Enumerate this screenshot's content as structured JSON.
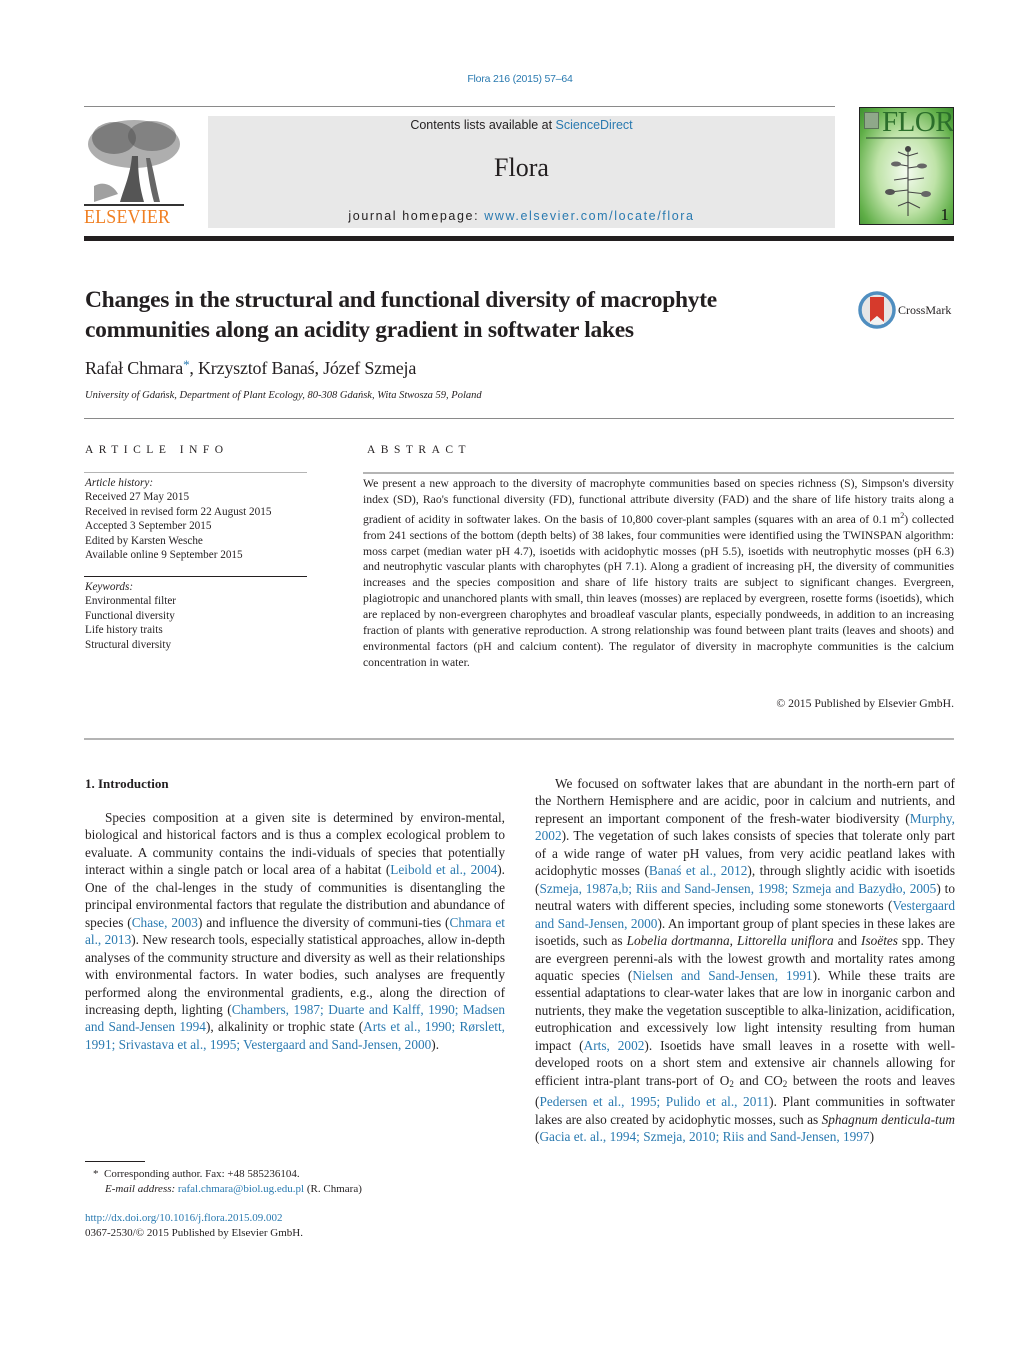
{
  "header": {
    "citation": "Flora 216 (2015) 57–64",
    "contents_prefix": "Contents lists available at ",
    "contents_link": "ScienceDirect",
    "journal_name": "Flora",
    "homepage_prefix": "journal homepage: ",
    "homepage_link": "www.elsevier.com/locate/flora",
    "publisher_logo_text": "ELSEVIER",
    "cover": {
      "title": "FLORA",
      "issue_number": "1"
    }
  },
  "article": {
    "title_line1": "Changes in the structural and functional diversity of macrophyte",
    "title_line2": "communities along an acidity gradient in softwater lakes",
    "crossmark_label": "CrossMark",
    "authors": [
      {
        "name": "Rafał Chmara",
        "marker": "*"
      },
      {
        "name": "Krzysztof Banaś"
      },
      {
        "name": "Józef Szmeja"
      }
    ],
    "affiliation": "University of Gdańsk, Department of Plant Ecology, 80-308 Gdańsk, Wita Stwosza 59, Poland"
  },
  "article_info": {
    "heading": "ARTICLE INFO",
    "history_label": "Article history:",
    "history": [
      "Received 27 May 2015",
      "Received in revised form 22 August 2015",
      "Accepted 3 September 2015",
      "Edited by Karsten Wesche",
      "Available online 9 September 2015"
    ],
    "keywords_label": "Keywords:",
    "keywords": [
      "Environmental filter",
      "Functional diversity",
      "Life history traits",
      "Structural diversity"
    ]
  },
  "abstract": {
    "heading": "ABSTRACT",
    "text_part1": "We present a new approach to the diversity of macrophyte communities based on species richness (S), Simpson's diversity index (SD), Rao's functional diversity (FD), functional attribute diversity (FAD) and the share of life history traits along a gradient of acidity in softwater lakes. On the basis of 10,800 cover-plant samples (squares with an area of 0.1 m",
    "text_sup": "2",
    "text_part2": ") collected from 241 sections of the bottom (depth belts) of 38 lakes, four communities were identified using the TWINSPAN algorithm: moss carpet (median water pH 4.7), isoetids with acidophytic mosses (pH 5.5), isoetids with neutrophytic mosses (pH 6.3) and neutrophytic vascular plants with charophytes (pH 7.1). Along a gradient of increasing pH, the diversity of communities increases and the species composition and share of life history traits are subject to significant changes. Evergreen, plagiotropic and unanchored plants with small, thin leaves (mosses) are replaced by evergreen, rosette forms (isoetids), which are replaced by non-evergreen charophytes and broadleaf vascular plants, especially pondweeds, in addition to an increasing fraction of plants with generative reproduction. A strong relationship was found between plant traits (leaves and shoots) and environmental factors (pH and calcium content). The regulator of diversity in macrophyte communities is the calcium concentration in water.",
    "copyright": "© 2015 Published by Elsevier GmbH."
  },
  "introduction": {
    "heading": "1.  Introduction",
    "left": {
      "t1": "Species composition at a given site is determined by environ-mental, biological and historical factors and is thus a complex ecological problem to evaluate. A community contains the indi-viduals of species that potentially interact within a single patch or local area of a habitat (",
      "c1": "Leibold et al., 2004",
      "t2": "). One of the chal-lenges in the study of communities is disentangling the principal environmental factors that regulate the distribution and abundance of species (",
      "c2": "Chase, 2003",
      "t3": ") and influence the diversity of communi-ties (",
      "c3": "Chmara et al., 2013",
      "t4": "). New research tools, especially statistical approaches, allow in-depth analyses of the community structure and diversity as well as their relationships with environmental factors. In water bodies, such analyses are frequently performed along the environmental gradients, e.g., along the direction of increasing depth, lighting (",
      "c4": "Chambers, 1987; Duarte and Kalff, 1990; Madsen and Sand-Jensen 1994",
      "t5": "), alkalinity or trophic state (",
      "c5": "Arts et al., 1990; Rørslett, 1991; Srivastava et al., 1995; Vestergaard and Sand-Jensen, 2000",
      "t6": ")."
    },
    "right": {
      "t1": "We focused on softwater lakes that are abundant in the north-ern part of the Northern Hemisphere and are acidic, poor in calcium and nutrients, and represent an important component of the fresh-water biodiversity (",
      "c1": "Murphy, 2002",
      "t2": "). The vegetation of such lakes consists of species that tolerate only part of a wide range of water pH values, from very acidic peatland lakes with acidophytic mosses (",
      "c2": "Banaś et al., 2012",
      "t3": "), through slightly acidic with isoetids (",
      "c3": "Szmeja, 1987a,b; Riis and Sand-Jensen, 1998; Szmeja and Bazydło, 2005",
      "t4": ") to neutral waters with different species, including some stoneworts (",
      "c4": "Vestergaard and Sand-Jensen, 2000",
      "t5": "). An important group of plant species in these lakes are isoetids, such as ",
      "i1": "Lobelia dortmanna",
      "t6": ", ",
      "i2": "Littorella uniflora",
      "t7": " and ",
      "i3": "Isoëtes",
      "t8": " spp. They are evergreen perenni-als with the lowest growth and mortality rates among aquatic species (",
      "c5": "Nielsen and Sand-Jensen, 1991",
      "t9": "). While these traits are essential adaptations to clear-water lakes that are low in inorganic carbon and nutrients, they make the vegetation susceptible to alka-linization, acidification, eutrophication and excessively low light intensity resulting from human impact (",
      "c6": "Arts, 2002",
      "t10": "). Isoetids have small leaves in a rosette with well-developed roots on a short stem and extensive air channels allowing for efficient intra-plant trans-port of O",
      "sub1": "2",
      "t11": " and CO",
      "sub2": "2",
      "t12": " between the roots and leaves (",
      "c7": "Pedersen et al., 1995; Pulido et al., 2011",
      "t13": "). Plant communities in softwater lakes are also created by acidophytic mosses, such as ",
      "i4": "Sphagnum denticula-tum",
      "t14": " (",
      "c8": "Gacia et. al., 1994; Szmeja, 2010; Riis and Sand-Jensen, 1997",
      "t15": ")"
    }
  },
  "footnote": {
    "marker": "*",
    "corresponding": "Corresponding author. Fax: +48 585236104.",
    "email_label": "E-mail address: ",
    "email": "rafal.chmara@biol.ug.edu.pl",
    "email_suffix": " (R. Chmara)",
    "doi": "http://dx.doi.org/10.1016/j.flora.2015.09.002",
    "issn_line": "0367-2530/© 2015 Published by Elsevier GmbH."
  },
  "colors": {
    "link": "#2a7ab0",
    "elsevier_orange": "#f07f22",
    "journal_box_bg": "#e8e8e8",
    "text": "#231f20"
  }
}
